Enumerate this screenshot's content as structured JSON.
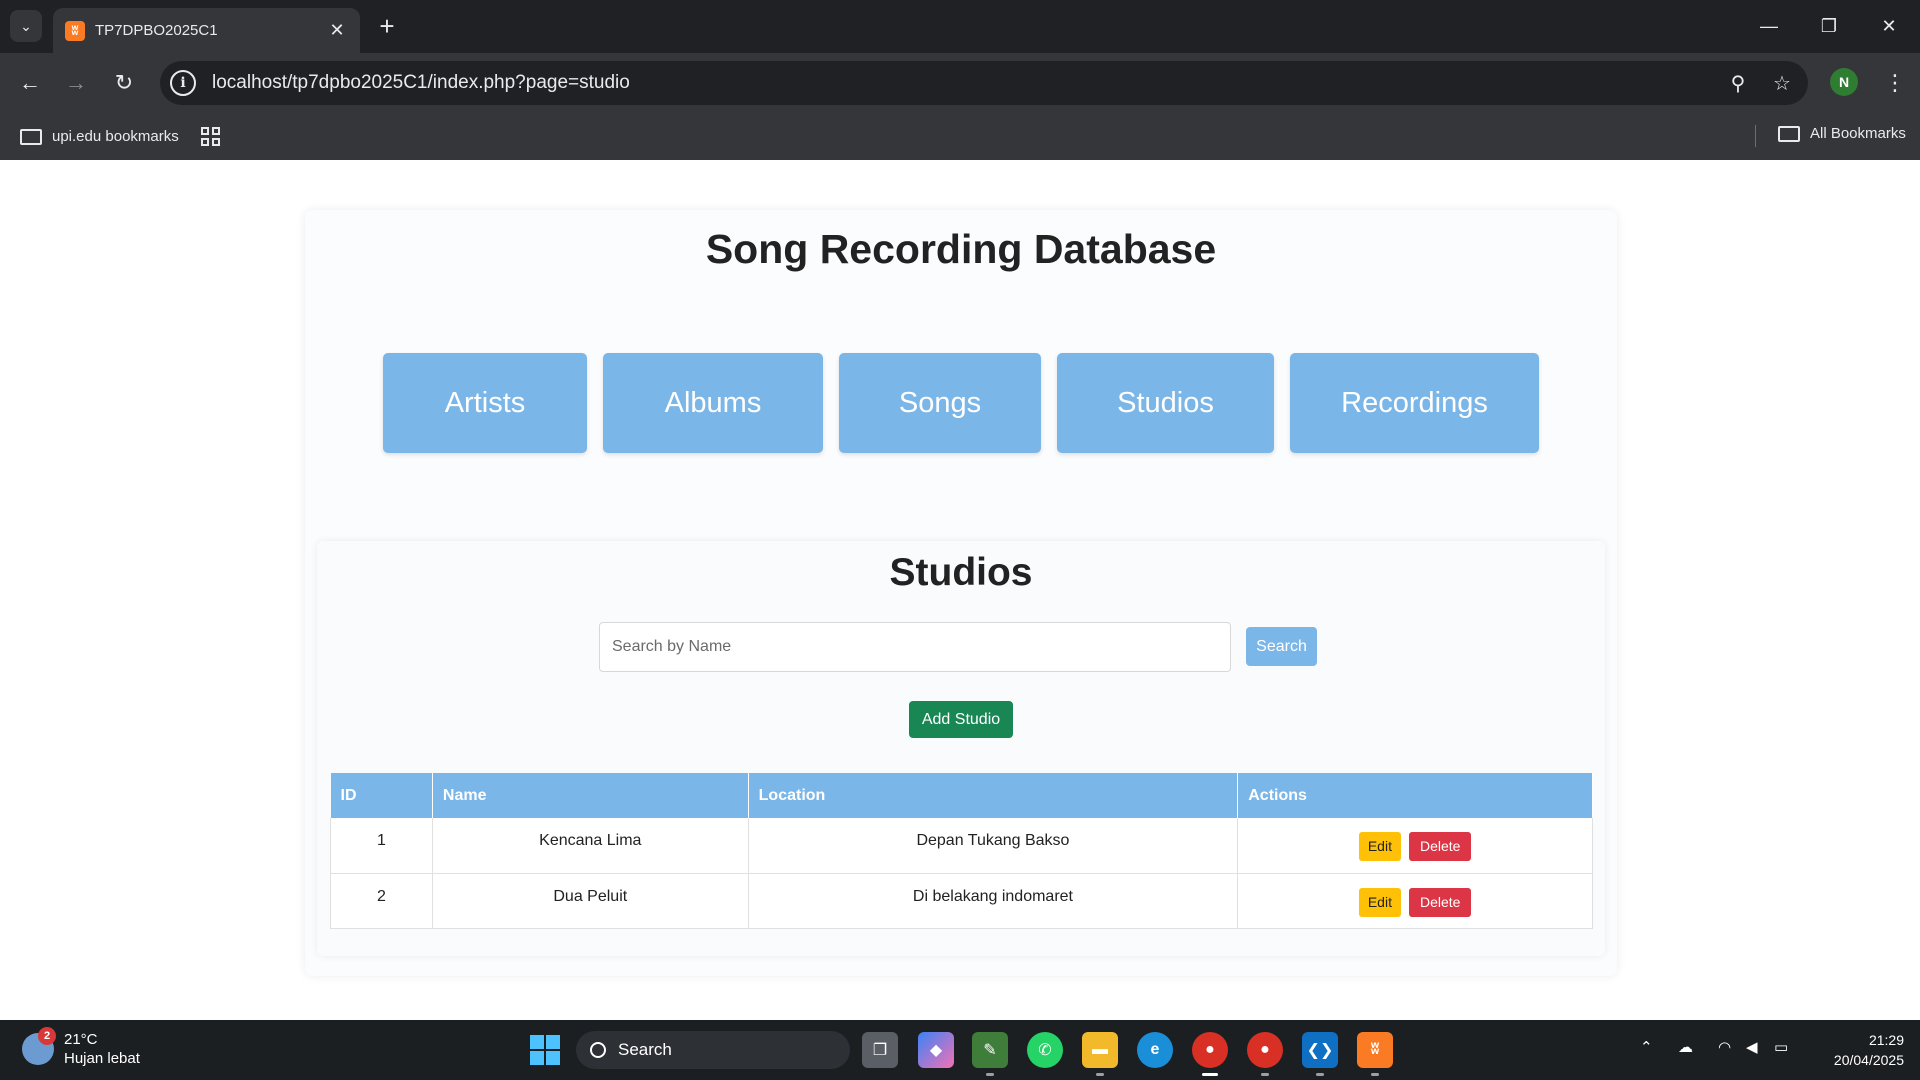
{
  "browser": {
    "tab_title": "TP7DPBO2025C1",
    "url": "localhost/tp7dpbo2025C1/index.php?page=studio",
    "bookmark_folder": "upi.edu bookmarks",
    "all_bookmarks": "All Bookmarks",
    "profile_initial": "N"
  },
  "page": {
    "title": "Song Recording Database",
    "nav": [
      "Artists",
      "Albums",
      "Songs",
      "Studios",
      "Recordings"
    ]
  },
  "studios": {
    "heading": "Studios",
    "search_placeholder": "Search by Name",
    "search_label": "Search",
    "add_label": "Add Studio",
    "columns": [
      "ID",
      "Name",
      "Location",
      "Actions"
    ],
    "rows": [
      {
        "id": "1",
        "name": "Kencana Lima",
        "location": "Depan Tukang Bakso"
      },
      {
        "id": "2",
        "name": "Dua Peluit",
        "location": "Di belakang indomaret"
      }
    ],
    "edit_label": "Edit",
    "delete_label": "Delete"
  },
  "taskbar": {
    "weather_temp": "21°C",
    "weather_desc": "Hujan lebat",
    "weather_badge": "2",
    "search_label": "Search",
    "time": "21:29",
    "date": "20/04/2025"
  },
  "colors": {
    "nav_button": "#7bb6e8",
    "add_button": "#198754",
    "edit_button": "#ffc107",
    "delete_button": "#dc3545"
  }
}
